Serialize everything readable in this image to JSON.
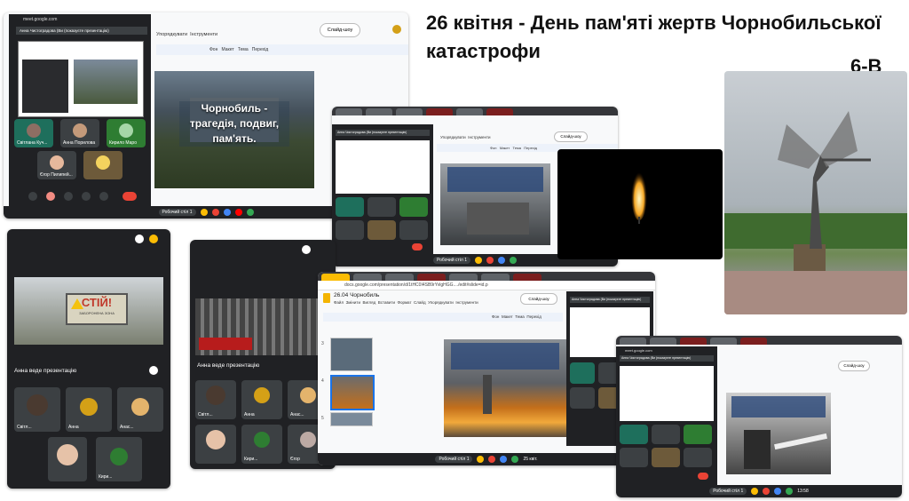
{
  "page_title": "26 квітня - День пам'яті жертв Чорнобильської катастрофи",
  "class_label": "6-В",
  "shot1": {
    "url": "meet.google.com",
    "presenter_bar": "Анна Чистоградова (Ви (показуєте презентацію)",
    "menu_arrange": "Упорядкувати",
    "menu_tools": "Інструменти",
    "slideshow_btn": "Слайд-шоу",
    "toolbar_items": [
      "Фон",
      "Макет",
      "Тема",
      "Перехід"
    ],
    "slide_text": "Чорнобиль - трагедія, подвиг, пам'ять.",
    "participants": [
      "Світлана Куч...",
      "Анна Порилова",
      "Кирило Маро",
      "Єгор Пилипей..."
    ],
    "desk_label": "Робочий стіл 1"
  },
  "shot2": {
    "presenter_bar": "Анна Чистоградова (Ви (показуєте презентацію)",
    "menu_arrange": "Упорядкувати",
    "menu_tools": "Інструменти",
    "slideshow_btn": "Слайд-шоу",
    "toolbar_items": [
      "Фон",
      "Макет",
      "Тема",
      "Перехід"
    ],
    "desk_label": "Робочий стіл 1"
  },
  "shot3": {
    "sign_text": "СТІЙ!",
    "sign_sub": "ЗАБОРОНЕНА ЗОНА",
    "presenting": "Анна веде презентацію",
    "participants": [
      "Світл...",
      "Анна",
      "Анас...",
      "Кири..."
    ]
  },
  "shot4": {
    "presenting": "Анна веде презентацію",
    "participants": [
      "Світл...",
      "Анна",
      "Анас...",
      "Кири...",
      "Єгор"
    ]
  },
  "shot5": {
    "doc_title": "26.04 Чорнобиль",
    "url": "docs.google.com/presentation/d/1tHC0I4SB9rYvlgHGG..../edit#slide=id.p",
    "menu": [
      "Файл",
      "Змінити",
      "Вигляд",
      "Вставити",
      "Формат",
      "Слайд",
      "Упорядкувати",
      "Інструменти"
    ],
    "slideshow_btn": "Слайд-шоу",
    "toolbar_items": [
      "Фон",
      "Макет",
      "Тема",
      "Перехід"
    ],
    "presenter_bar": "Анна Чистоградова (Ви (показуєте презентацію)",
    "slide_numbers": [
      "3",
      "4",
      "5"
    ],
    "desk_label": "Робочий стіл 1",
    "date": "25 квіт."
  },
  "shot6": {
    "url": "meet.google.com",
    "presenter_bar": "Анна Чистоградова (Ви (показуєте презентацію)",
    "slideshow_btn": "Слайд-шоу",
    "desk_label": "Робочий стіл 1",
    "time": "13:58"
  },
  "colors": {
    "meet_bg": "#202124",
    "tile": "#3c4043",
    "end_call": "#ea4335",
    "accent_blue": "#1a73e8"
  }
}
